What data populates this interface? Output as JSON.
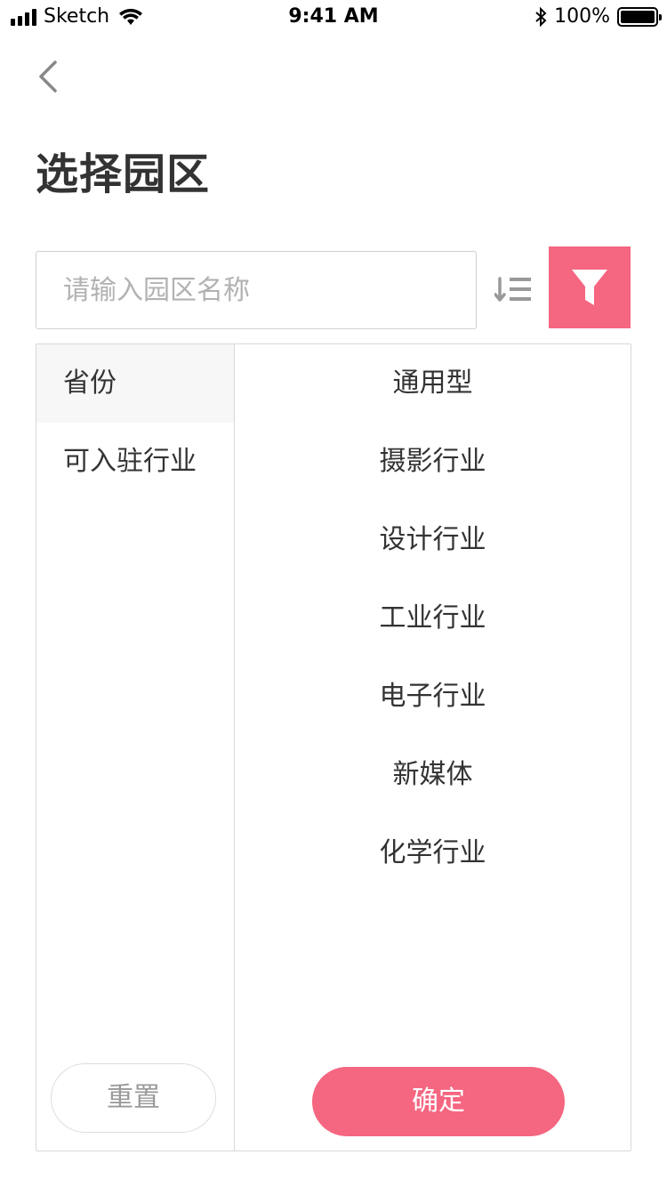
{
  "status_bar": {
    "carrier": "Sketch",
    "time": "9:41 AM",
    "battery_percent": "100%",
    "icons": [
      "signal-icon",
      "wifi-icon",
      "bluetooth-icon",
      "battery-icon"
    ]
  },
  "nav": {
    "back_icon": "chevron-left-icon"
  },
  "page": {
    "title": "选择园区"
  },
  "search": {
    "placeholder": "请输入园区名称",
    "value": ""
  },
  "toolbar": {
    "sort_icon": "sort-list-icon",
    "filter_icon": "funnel-icon"
  },
  "filter": {
    "categories": [
      {
        "label": "省份",
        "active": true
      },
      {
        "label": "可入驻行业",
        "active": false
      }
    ],
    "options": [
      "通用型",
      "摄影行业",
      "设计行业",
      "工业行业",
      "电子行业",
      "新媒体",
      "化学行业"
    ],
    "reset_label": "重置",
    "confirm_label": "确定"
  },
  "colors": {
    "accent": "#f56681",
    "text": "#333333",
    "border": "#d8d8d8",
    "placeholder": "#b2b2b2"
  }
}
